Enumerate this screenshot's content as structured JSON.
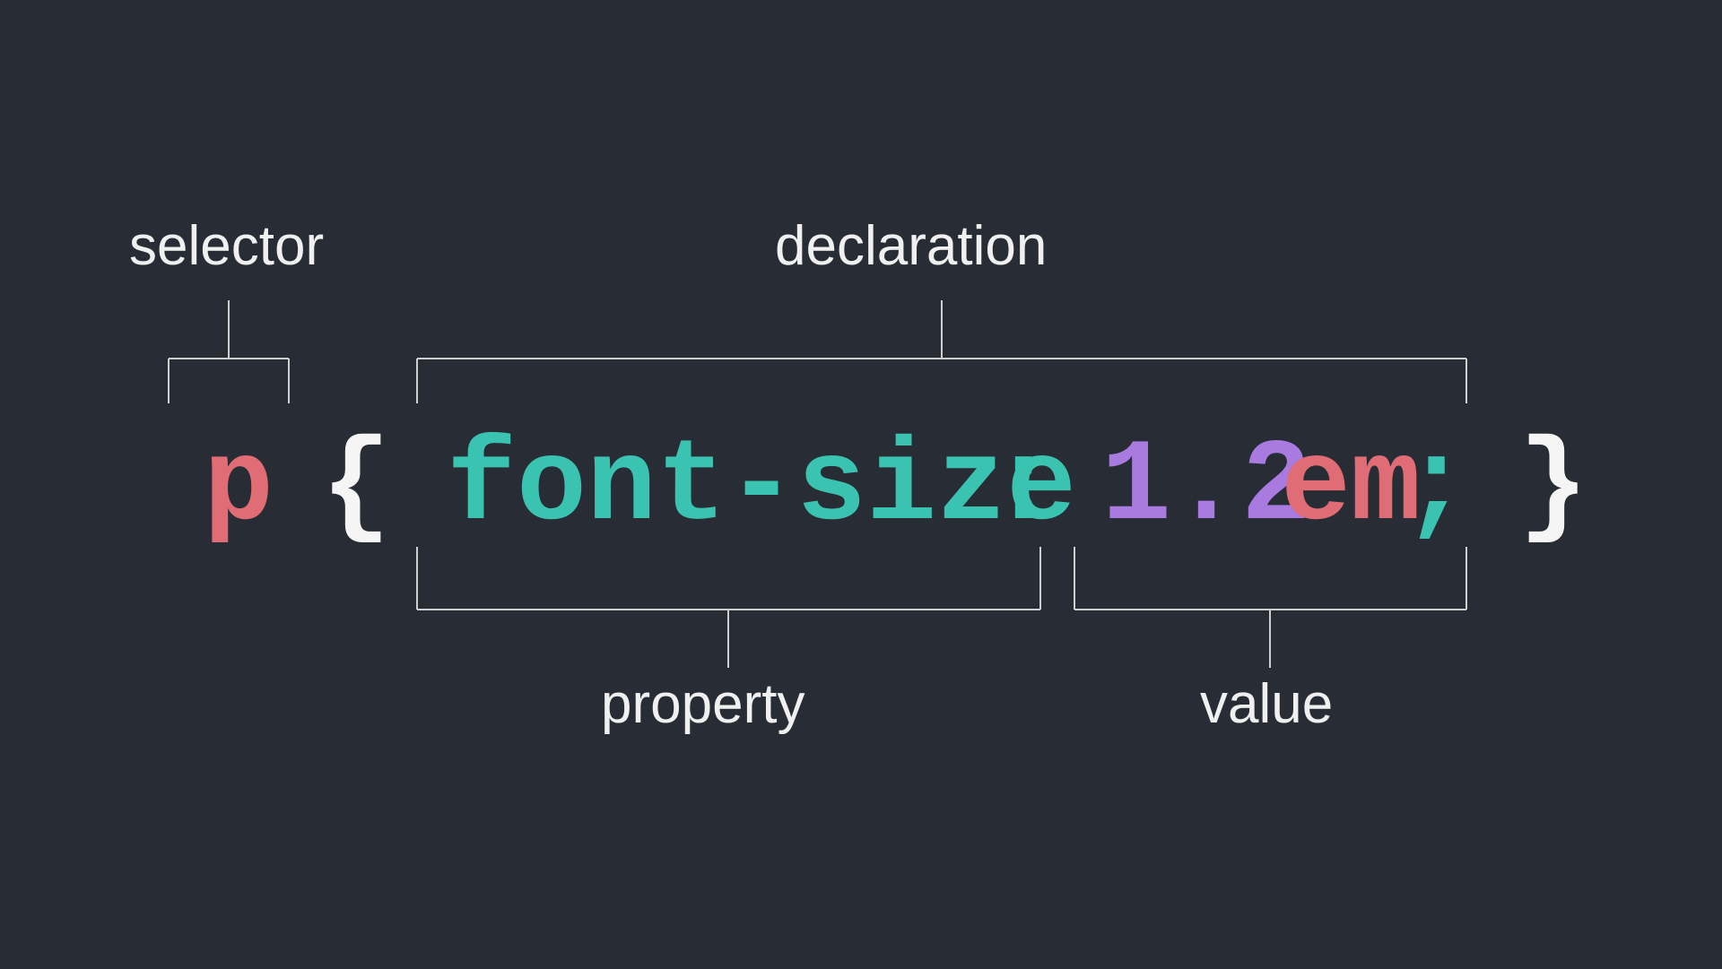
{
  "labels": {
    "selector": "selector",
    "declaration": "declaration",
    "property": "property",
    "value": "value"
  },
  "code": {
    "selector": "p",
    "brace_open": "{",
    "property": "font-size",
    "colon": ":",
    "value_number": "1.2",
    "value_unit": "em",
    "semicolon": ";",
    "brace_close": "}"
  },
  "colors": {
    "background": "#282c34",
    "text": "#f0f0f0",
    "selector": "#e06c75",
    "brace": "#f5f5f5",
    "property": "#3bc3b2",
    "punctuation": "#3bc3b2",
    "number": "#a97ae0",
    "unit": "#e06c75",
    "bracket_line": "#cfcfcf"
  }
}
